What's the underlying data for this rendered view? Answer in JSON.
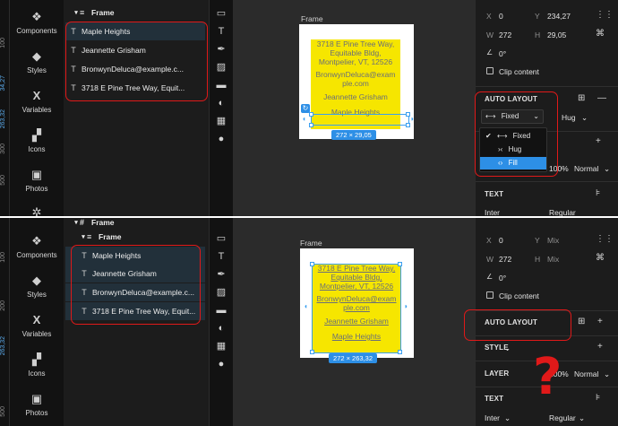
{
  "top": {
    "ruler_ticks": [
      "100",
      "34,27",
      "263,32",
      "300",
      "500"
    ],
    "nav": [
      {
        "label": "Components",
        "icon": "components-icon"
      },
      {
        "label": "Styles",
        "icon": "styles-icon"
      },
      {
        "label": "Variables",
        "icon": "variables-icon"
      },
      {
        "label": "Icons",
        "icon": "icons-icon"
      },
      {
        "label": "Photos",
        "icon": "photos-icon"
      }
    ],
    "parent_layer": "Frame",
    "layers": [
      "Maple Heights",
      "Jeannette Grisham",
      "BronwynDeluca@example.c...",
      "3718 E Pine Tree Way, Equit..."
    ],
    "frame_label": "Frame",
    "frame_text": [
      "3718 E Pine Tree Way,",
      "Equitable Bldg,",
      "Montpelier, VT, 12526",
      "BronwynDeluca@exam",
      "ple.com",
      "Jeannette Grisham",
      "Maple Heights"
    ],
    "dimension_badge": "272 × 29,05",
    "props": {
      "x_label": "X",
      "x_value": "0",
      "y_label": "Y",
      "y_value": "234,27",
      "w_label": "W",
      "w_value": "272",
      "h_label": "H",
      "h_value": "29,05",
      "rotation": "0°",
      "clip_content": "Clip content"
    },
    "auto_layout_title": "AUTO LAYOUT",
    "width_mode": "Fixed",
    "height_mode": "Hug",
    "dropdown_options": [
      "Fixed",
      "Hug",
      "Fill"
    ],
    "opacity": "100%",
    "blend": "Normal",
    "text_title": "TEXT",
    "font_family": "Inter",
    "font_weight": "Regular"
  },
  "bottom": {
    "ruler_ticks": [
      "100",
      "200",
      "263,32",
      "500"
    ],
    "nav": [
      {
        "label": "Components",
        "icon": "components-icon"
      },
      {
        "label": "Styles",
        "icon": "styles-icon"
      },
      {
        "label": "Variables",
        "icon": "variables-icon"
      },
      {
        "label": "Icons",
        "icon": "icons-icon"
      },
      {
        "label": "Photos",
        "icon": "photos-icon"
      }
    ],
    "parent_layer_top": "Frame",
    "parent_layer": "Frame",
    "layers": [
      "Maple Heights",
      "Jeannette Grisham",
      "BronwynDeluca@example.c...",
      "3718 E Pine Tree Way, Equit..."
    ],
    "frame_label": "Frame",
    "frame_text": [
      "3718 E Pine Tree Way,",
      "Equitable Bldg,",
      "Montpelier, VT, 12526",
      "BronwynDeluca@exam",
      "ple.com",
      "Jeannette Grisham",
      "Maple Heights"
    ],
    "dimension_badge": "272 × 263,32",
    "props": {
      "x_label": "X",
      "x_value": "0",
      "y_label": "Y",
      "y_value": "Mix",
      "w_label": "W",
      "w_value": "272",
      "h_label": "H",
      "h_value": "Mix",
      "rotation": "0°",
      "clip_content": "Clip content"
    },
    "auto_layout_title": "AUTO LAYOUT",
    "style_title": "STYLE",
    "layer_title": "LAYER",
    "opacity": "100%",
    "blend": "Normal",
    "text_title": "TEXT",
    "font_family": "Inter",
    "font_weight": "Regular",
    "question_mark": "?"
  },
  "colors": {
    "accent": "#2d8fe6",
    "highlight_yellow": "#f6e600",
    "annotation_red": "#e01919"
  }
}
